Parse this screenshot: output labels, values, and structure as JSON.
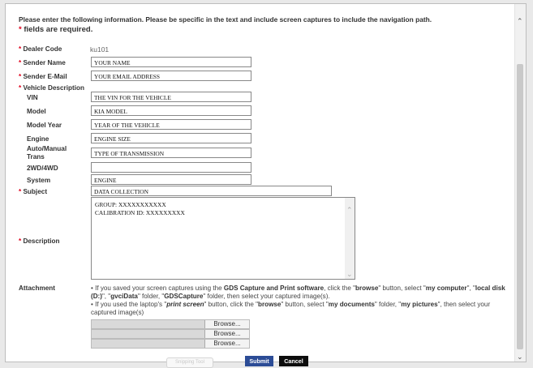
{
  "intro_text": "Please enter the following information. Please be specific in the text and include screen captures to include the navigation path.",
  "required_star": "*",
  "required_text": "fields are required.",
  "fields": {
    "dealer_code": {
      "label": "Dealer Code",
      "value": "ku101"
    },
    "sender_name": {
      "label": "Sender Name",
      "value": "YOUR NAME"
    },
    "sender_email": {
      "label": "Sender E-Mail",
      "value": "YOUR EMAIL ADDRESS"
    },
    "vehicle_description": {
      "label": "Vehicle Description"
    },
    "vin": {
      "label": "VIN",
      "value": "THE VIN FOR THE VEHICLE"
    },
    "model": {
      "label": "Model",
      "value": "KIA MODEL"
    },
    "model_year": {
      "label": "Model Year",
      "value": "YEAR OF THE VEHICLE"
    },
    "engine": {
      "label": "Engine",
      "value": "ENGINE SIZE"
    },
    "trans_label_1": "Auto/Manual",
    "trans_label_2": "Trans",
    "trans_value": "TYPE OF TRANSMISSION",
    "drive": {
      "label": "2WD/4WD",
      "value": ""
    },
    "system": {
      "label": "System",
      "value": "ENGINE"
    },
    "subject": {
      "label": "Subject",
      "value": "DATA COLLECTION"
    },
    "description": {
      "label": "Description",
      "lines": [
        "GROUP: XXXXXXXXXXX",
        "CALIBRATION ID: XXXXXXXXX"
      ]
    },
    "attachment": {
      "label": "Attachment"
    }
  },
  "attachment_help": {
    "bullet": "•",
    "p1_a": " If you saved your screen captures using the ",
    "p1_b": "GDS Capture and Print software",
    "p1_c": ", click the \"",
    "p1_d": "browse",
    "p1_e": "\" button, select \"",
    "p1_f": "my computer",
    "p1_g": "\", \"",
    "p1_h": "local disk (D:)",
    "p1_i": "\", \"",
    "p1_j": "gvciData",
    "p1_k": "\" folder, \"",
    "p1_l": "GDSCapture",
    "p1_m": "\" folder, then select your captured image(s).",
    "p2_a": " If you used the laptop's \"",
    "p2_b": "print screen",
    "p2_c": "\" button, click the \"",
    "p2_d": "browse",
    "p2_e": "\" button, select \"",
    "p2_f": "my documents",
    "p2_g": "\" folder, \"",
    "p2_h": "my pictures",
    "p2_i": "\", then select your captured image(s)"
  },
  "browse_label": "Browse...",
  "buttons": {
    "snipping": "Snipping Tool",
    "submit": "Submit",
    "cancel": "Cancel"
  },
  "colors": {
    "required": "#e0001b",
    "submit_bg": "#2c4c96",
    "cancel_bg": "#0d0d0d"
  }
}
